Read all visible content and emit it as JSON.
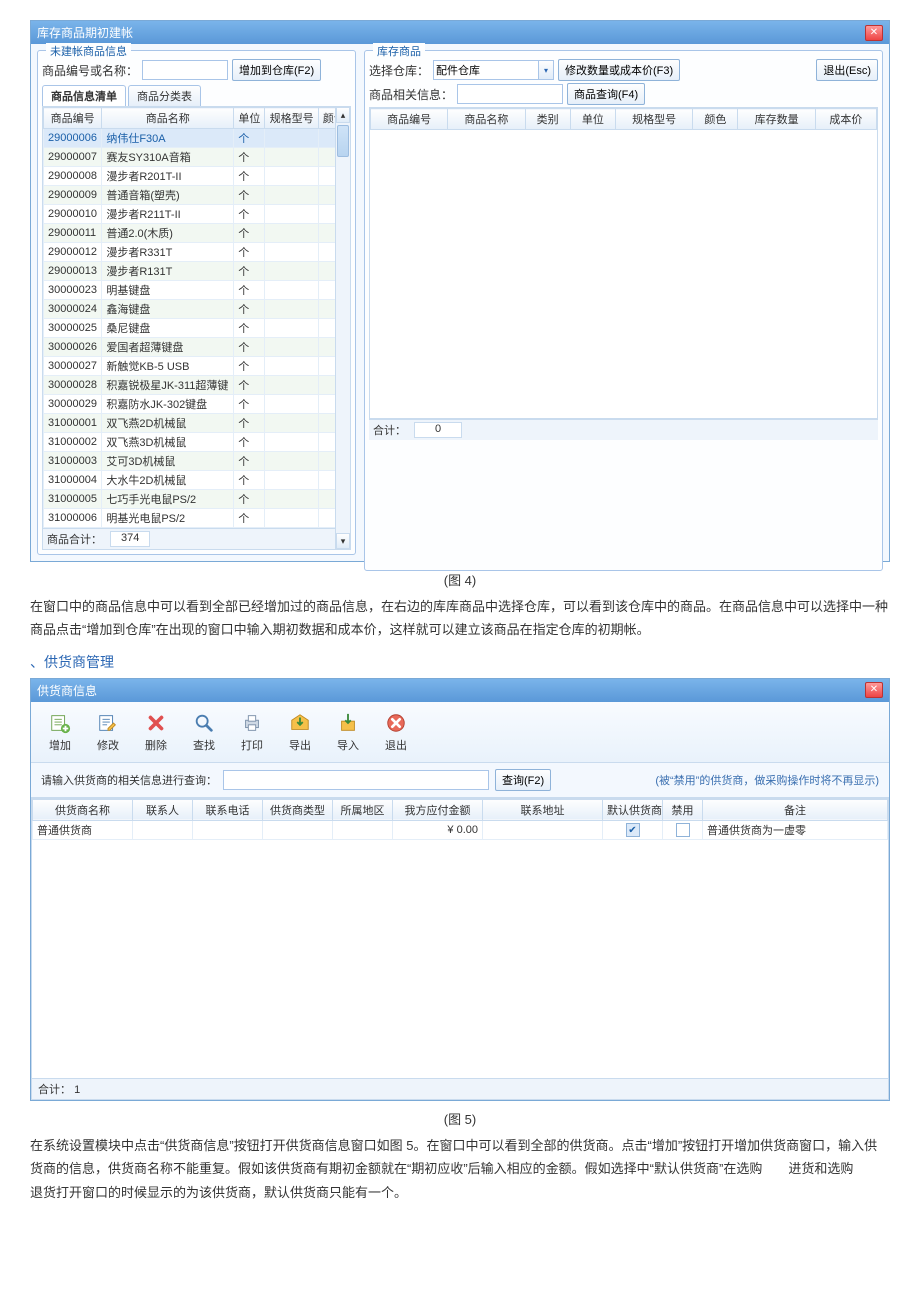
{
  "fig4": {
    "window_title": "库存商品期初建帐",
    "left": {
      "group_title": "未建帐商品信息",
      "search_label": "商品编号或名称：",
      "add_btn": "增加到仓库(F2)",
      "tabs": {
        "list": "商品信息清单",
        "category": "商品分类表"
      },
      "headers": [
        "商品编号",
        "商品名称",
        "单位",
        "规格型号",
        "颜色"
      ],
      "rows": [
        [
          "29000006",
          "纳伟仕F30A",
          "个",
          "",
          ""
        ],
        [
          "29000007",
          "赛友SY310A音箱",
          "个",
          "",
          ""
        ],
        [
          "29000008",
          "漫步者R201T-II",
          "个",
          "",
          ""
        ],
        [
          "29000009",
          "普通音箱(塑壳)",
          "个",
          "",
          ""
        ],
        [
          "29000010",
          "漫步者R211T-II",
          "个",
          "",
          ""
        ],
        [
          "29000011",
          "普通2.0(木质)",
          "个",
          "",
          ""
        ],
        [
          "29000012",
          "漫步者R331T",
          "个",
          "",
          ""
        ],
        [
          "29000013",
          "漫步者R131T",
          "个",
          "",
          ""
        ],
        [
          "30000023",
          "明基键盘",
          "个",
          "",
          ""
        ],
        [
          "30000024",
          "鑫海键盘",
          "个",
          "",
          ""
        ],
        [
          "30000025",
          "桑尼键盘",
          "个",
          "",
          ""
        ],
        [
          "30000026",
          "爱国者超薄键盘",
          "个",
          "",
          ""
        ],
        [
          "30000027",
          "新触觉KB-5 USB",
          "个",
          "",
          ""
        ],
        [
          "30000028",
          "积嘉锐极星JK-311超薄键",
          "个",
          "",
          ""
        ],
        [
          "30000029",
          "积嘉防水JK-302键盘",
          "个",
          "",
          ""
        ],
        [
          "31000001",
          "双飞燕2D机械鼠",
          "个",
          "",
          ""
        ],
        [
          "31000002",
          "双飞燕3D机械鼠",
          "个",
          "",
          ""
        ],
        [
          "31000003",
          "艾可3D机械鼠",
          "个",
          "",
          ""
        ],
        [
          "31000004",
          "大水牛2D机械鼠",
          "个",
          "",
          ""
        ],
        [
          "31000005",
          "七巧手光电鼠PS/2",
          "个",
          "",
          ""
        ],
        [
          "31000006",
          "明基光电鼠PS/2",
          "个",
          "",
          ""
        ]
      ],
      "footer_label": "商品合计：",
      "footer_value": "374"
    },
    "right": {
      "group_title": "库存商品",
      "warehouse_label": "选择仓库：",
      "warehouse_value": "配件仓库",
      "modify_btn": "修改数量或成本价(F3)",
      "exit_btn": "退出(Esc)",
      "filter_label": "商品相关信息：",
      "query_btn": "商品查询(F4)",
      "headers": [
        "商品编号",
        "商品名称",
        "类别",
        "单位",
        "规格型号",
        "颜色",
        "库存数量",
        "成本价"
      ],
      "sum_label": "合计：",
      "sum_value": "0"
    }
  },
  "caption4": "(图 4)",
  "para4": "在窗口中的商品信息中可以看到全部已经增加过的商品信息，在右边的库库商品中选择仓库，可以看到该仓库中的商品。在商品信息中可以选择中一种商品点击“增加到仓库”在出现的窗口中输入期初数据和成本价，这样就可以建立该商品在指定仓库的初期帐。",
  "section5_marker": "、",
  "section5_title": "供货商管理",
  "fig5": {
    "window_title": "供货商信息",
    "toolbar": {
      "add": "增加",
      "edit": "修改",
      "del": "删除",
      "find": "查找",
      "print": "打印",
      "export": "导出",
      "import": "导入",
      "exit": "退出"
    },
    "query_label": "请输入供货商的相关信息进行查询：",
    "query_btn": "查询(F2)",
    "query_hint": "(被“禁用”的供货商，做采购操作时将不再显示)",
    "headers": [
      "供货商名称",
      "联系人",
      "联系电话",
      "供货商类型",
      "所属地区",
      "我方应付金额",
      "联系地址",
      "默认供货商",
      "禁用",
      "备注"
    ],
    "row": {
      "name": "普通供货商",
      "contact": "",
      "phone": "",
      "type": "",
      "region": "",
      "amount": "¥ 0.00",
      "address": "",
      "default": true,
      "disabled": false,
      "remark": "普通供货商为一虚零"
    },
    "footer_label": "合计：",
    "footer_value": "1"
  },
  "caption5": "(图 5)",
  "para5": "在系统设置模块中点击“供货商信息”按钮打开供货商信息窗口如图 5。在窗口中可以看到全部的供货商。点击“增加”按钮打开增加供货商窗口，输入供货商的信息，供货商名称不能重复。假如该供货商有期初金额就在“期初应收”后输入相应的金额。假如选择中“默认供货商”在选购　　进货和选购　　退货打开窗口的时候显示的为该供货商，默认供货商只能有一个。"
}
